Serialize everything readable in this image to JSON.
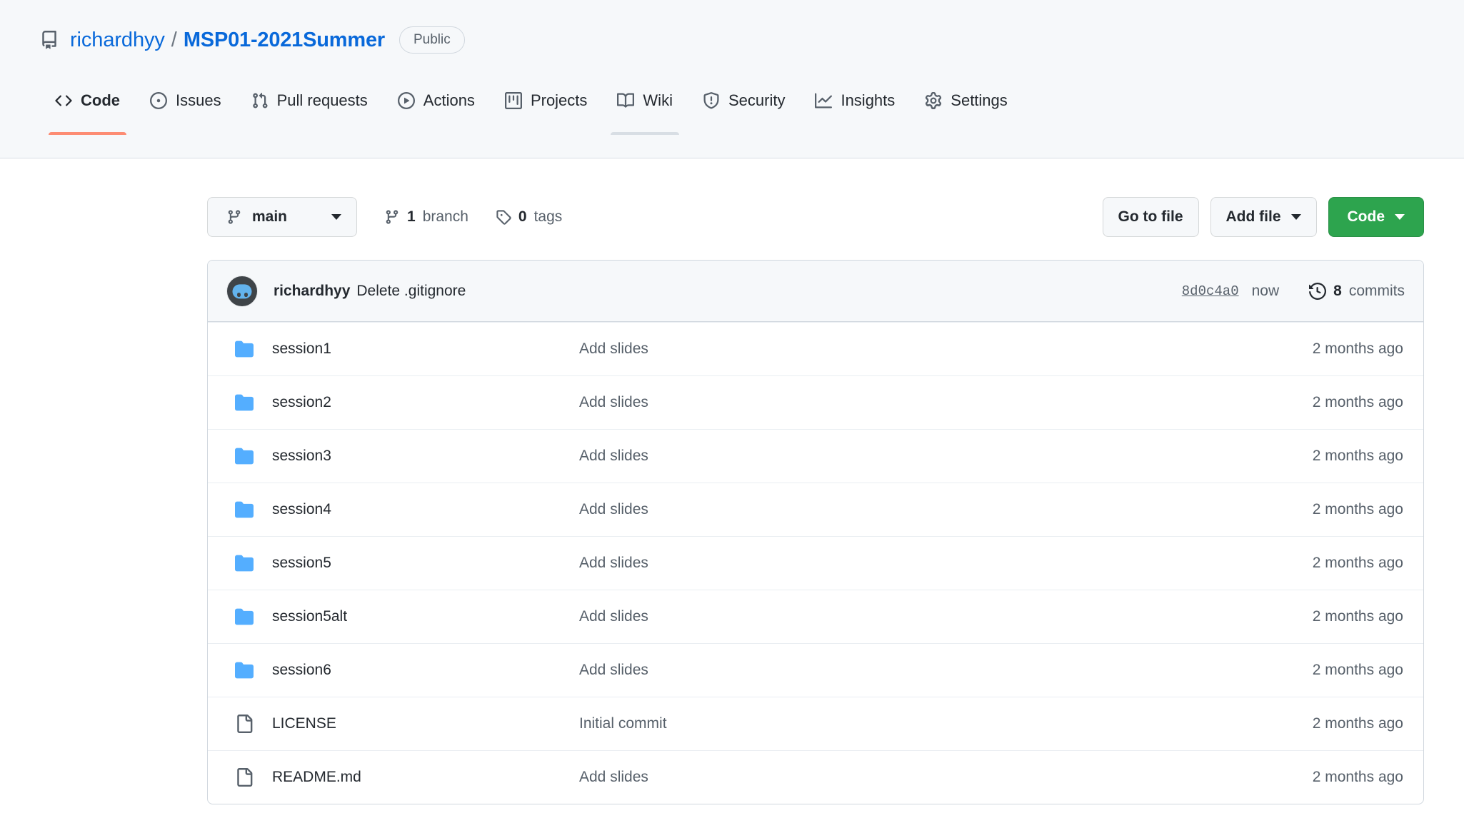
{
  "repo": {
    "icon": "repo-icon",
    "owner": "richardhyy",
    "separator": "/",
    "name": "MSP01-2021Summer",
    "visibility": "Public"
  },
  "nav": {
    "items": [
      {
        "label": "Code",
        "icon": "code-icon",
        "state": "selected"
      },
      {
        "label": "Issues",
        "icon": "issue-opened-icon",
        "state": "normal"
      },
      {
        "label": "Pull requests",
        "icon": "git-pull-request-icon",
        "state": "normal"
      },
      {
        "label": "Actions",
        "icon": "play-icon",
        "state": "normal"
      },
      {
        "label": "Projects",
        "icon": "project-icon",
        "state": "normal"
      },
      {
        "label": "Wiki",
        "icon": "book-icon",
        "state": "hovered"
      },
      {
        "label": "Security",
        "icon": "shield-icon",
        "state": "normal"
      },
      {
        "label": "Insights",
        "icon": "graph-icon",
        "state": "normal"
      },
      {
        "label": "Settings",
        "icon": "gear-icon",
        "state": "normal"
      }
    ]
  },
  "toolbar": {
    "branch_selector": {
      "label": "main",
      "icon": "git-branch-icon"
    },
    "branch_count": {
      "count": "1",
      "label": "branch",
      "icon": "git-branch-icon"
    },
    "tag_count": {
      "count": "0",
      "label": "tags",
      "icon": "tag-icon"
    },
    "go_to_file": "Go to file",
    "add_file": "Add file",
    "code": "Code"
  },
  "latest_commit": {
    "avatar": "richardhyy-avatar",
    "author": "richardhyy",
    "message": "Delete .gitignore",
    "sha": "8d0c4a0",
    "time": "now",
    "commits_count": "8",
    "commits_label": "commits",
    "history_icon": "history-icon"
  },
  "files": [
    {
      "name": "session1",
      "type": "folder",
      "commit": "Add slides",
      "age": "2 months ago"
    },
    {
      "name": "session2",
      "type": "folder",
      "commit": "Add slides",
      "age": "2 months ago"
    },
    {
      "name": "session3",
      "type": "folder",
      "commit": "Add slides",
      "age": "2 months ago"
    },
    {
      "name": "session4",
      "type": "folder",
      "commit": "Add slides",
      "age": "2 months ago"
    },
    {
      "name": "session5",
      "type": "folder",
      "commit": "Add slides",
      "age": "2 months ago"
    },
    {
      "name": "session5alt",
      "type": "folder",
      "commit": "Add slides",
      "age": "2 months ago"
    },
    {
      "name": "session6",
      "type": "folder",
      "commit": "Add slides",
      "age": "2 months ago"
    },
    {
      "name": "LICENSE",
      "type": "file",
      "commit": "Initial commit",
      "age": "2 months ago"
    },
    {
      "name": "README.md",
      "type": "file",
      "commit": "Add slides",
      "age": "2 months ago"
    }
  ],
  "colors": {
    "link": "#0969da",
    "header_bg": "#f6f8fa",
    "active_tab": "#fd8c73",
    "code_button": "#2da44e",
    "folder_icon": "#54aeff",
    "border": "#d0d7de"
  }
}
